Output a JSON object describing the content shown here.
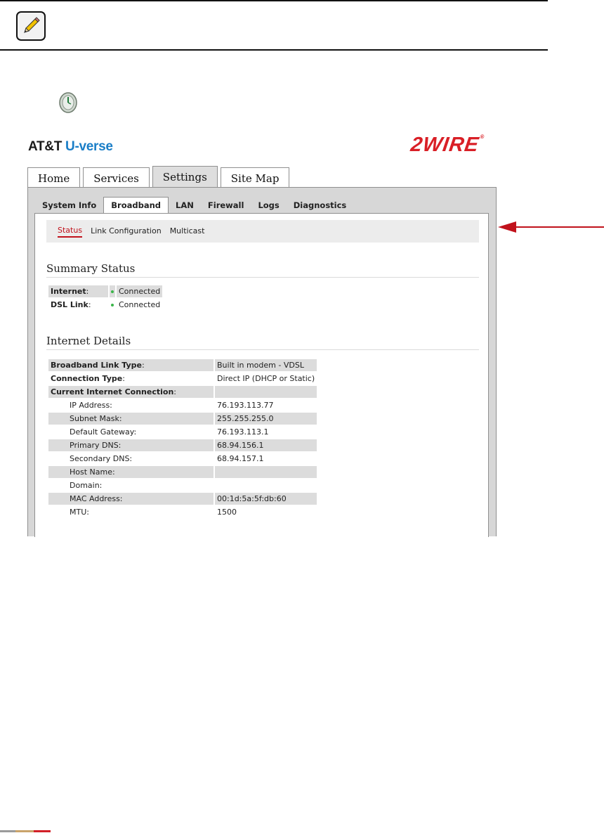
{
  "brand": {
    "att_prefix": "AT&T",
    "att_product": "U-verse",
    "vendor_logo": "2WIRE"
  },
  "main_tabs": [
    {
      "label": "Home",
      "active": false
    },
    {
      "label": "Services",
      "active": false
    },
    {
      "label": "Settings",
      "active": true
    },
    {
      "label": "Site Map",
      "active": false
    }
  ],
  "sub_tabs": [
    {
      "label": "System Info",
      "active": false
    },
    {
      "label": "Broadband",
      "active": true
    },
    {
      "label": "LAN",
      "active": false
    },
    {
      "label": "Firewall",
      "active": false
    },
    {
      "label": "Logs",
      "active": false
    },
    {
      "label": "Diagnostics",
      "active": false
    }
  ],
  "sub_nav": [
    {
      "label": "Status",
      "active": true
    },
    {
      "label": "Link Configuration",
      "active": false
    },
    {
      "label": "Multicast",
      "active": false
    }
  ],
  "summary": {
    "title": "Summary Status",
    "rows": [
      {
        "label": "Internet",
        "suffix": ":",
        "value": "Connected"
      },
      {
        "label": "DSL Link",
        "suffix": ":",
        "value": "Connected"
      }
    ]
  },
  "details": {
    "title": "Internet Details",
    "rows": [
      {
        "label": "Broadband Link Type",
        "suffix": ":",
        "value": "Built in modem - VDSL",
        "bold": true
      },
      {
        "label": "Connection Type",
        "suffix": ":",
        "value": "Direct IP (DHCP or Static)",
        "bold": true
      },
      {
        "label": "Current Internet Connection",
        "suffix": ":",
        "value": "",
        "bold": true
      },
      {
        "label": "IP Address:",
        "value": "76.193.113.77"
      },
      {
        "label": "Subnet Mask:",
        "value": "255.255.255.0"
      },
      {
        "label": "Default Gateway:",
        "value": "76.193.113.1"
      },
      {
        "label": "Primary DNS:",
        "value": "68.94.156.1"
      },
      {
        "label": "Secondary DNS:",
        "value": "68.94.157.1"
      },
      {
        "label": "Host Name:",
        "value": ""
      },
      {
        "label": "Domain:",
        "value": ""
      },
      {
        "label": "MAC Address:",
        "value": "00:1d:5a:5f:db:60"
      },
      {
        "label": "MTU:",
        "value": "1500"
      }
    ]
  },
  "colors": {
    "accent": "#c1121c",
    "status_ok": "#3bb54a",
    "att_blue": "#1a7ec7",
    "wire_red": "#d91f26"
  },
  "icons": {
    "note": "pencil-icon",
    "clock": "clock-icon",
    "arrow": "arrow-left-icon"
  }
}
